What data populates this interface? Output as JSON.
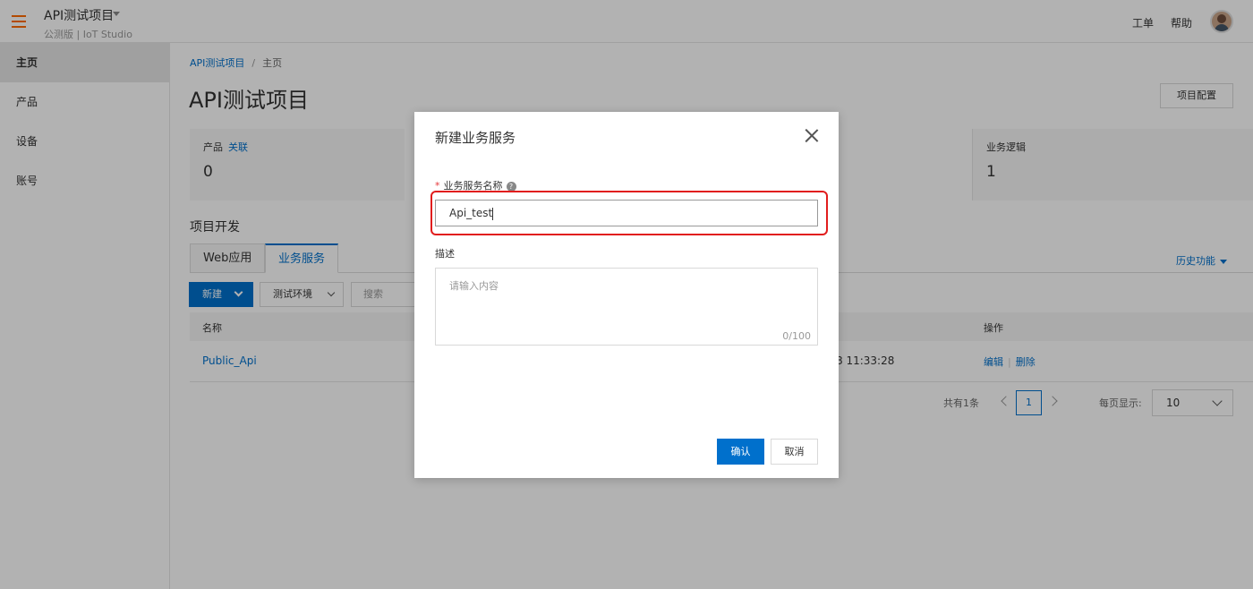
{
  "topbar": {
    "project_name": "API测试项目",
    "subtitle": "公测版 | IoT Studio",
    "links": [
      "工单",
      "帮助"
    ]
  },
  "sidebar": {
    "items": [
      {
        "label": "主页"
      },
      {
        "label": "产品"
      },
      {
        "label": "设备"
      },
      {
        "label": "账号"
      }
    ]
  },
  "main": {
    "breadcrumb": [
      "API测试项目",
      "/",
      "主页"
    ],
    "title": "API测试项目",
    "config_button": "项目配置",
    "stats": [
      {
        "label": "产品",
        "link": "关联",
        "value": "0"
      },
      {
        "label": "业务逻辑",
        "link": "",
        "value": "1"
      }
    ],
    "section_title": "项目开发",
    "tabs": [
      "Web应用",
      "业务服务"
    ],
    "history_link": "历史功能",
    "new_button": "新建",
    "env_select": "测试环境",
    "search_placeholder": "搜索",
    "table": {
      "headers": [
        "名称",
        "操作"
      ],
      "rows": [
        {
          "name": "Public_Api",
          "time": "8 11:33:28",
          "edit": "编辑",
          "sep": "|",
          "delete": "删除"
        }
      ]
    },
    "pager": {
      "total": "共有1条",
      "page": "1",
      "size_label": "每页显示:",
      "size": "10"
    }
  },
  "dialog": {
    "title": "新建业务服务",
    "name_label": "业务服务名称",
    "required_mark": "*",
    "help_glyph": "?",
    "name_value": "Api_test",
    "desc_label": "描述",
    "desc_placeholder": "请输入内容",
    "desc_count": "0/100",
    "ok": "确认",
    "cancel": "取消"
  },
  "colors": {
    "primary": "#0070cc",
    "menu_accent": "#ff6a00",
    "highlight": "#e11d1d"
  }
}
